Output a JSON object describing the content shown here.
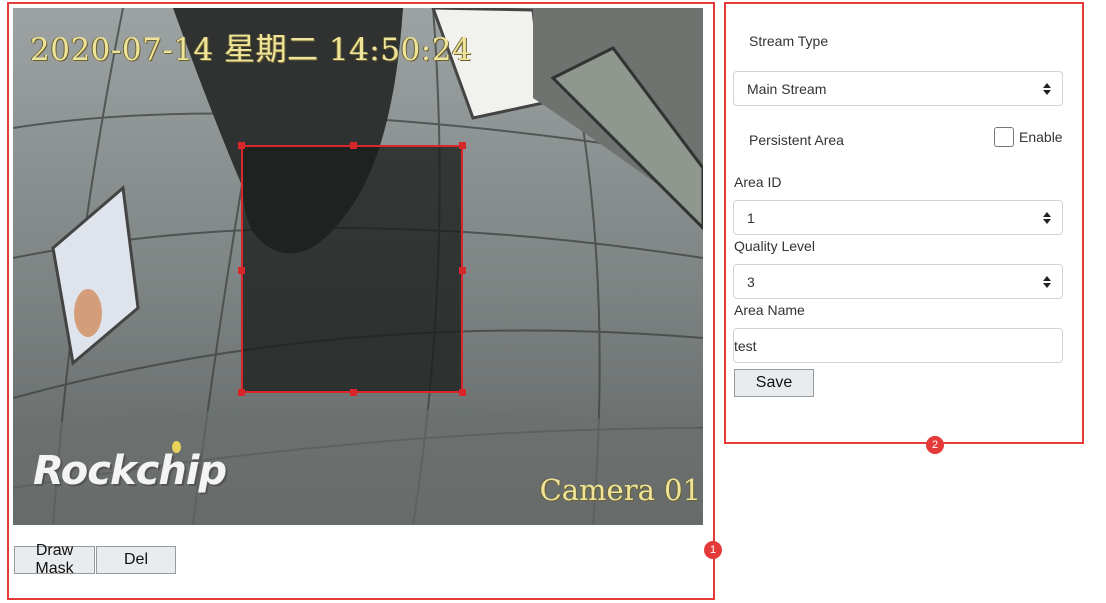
{
  "video": {
    "osd_time": "2020-07-14 星期二 14:50:24",
    "osd_camera": "Camera 01",
    "logo": "Rockchip"
  },
  "buttons": {
    "draw_mask": "Draw Mask",
    "del": "Del"
  },
  "settings": {
    "stream_type_label": "Stream Type",
    "stream_type_value": "Main Stream",
    "persistent_area_label": "Persistent Area",
    "enable_label": "Enable",
    "enable_checked": false,
    "area_id_label": "Area ID",
    "area_id_value": "1",
    "quality_level_label": "Quality Level",
    "quality_level_value": "3",
    "area_name_label": "Area Name",
    "area_name_value": "test",
    "save_label": "Save"
  },
  "annotations": {
    "badge1": "1",
    "badge2": "2",
    "color": "#e53a3a"
  },
  "icons": [
    "select-caret-icon",
    "checkbox-icon"
  ]
}
